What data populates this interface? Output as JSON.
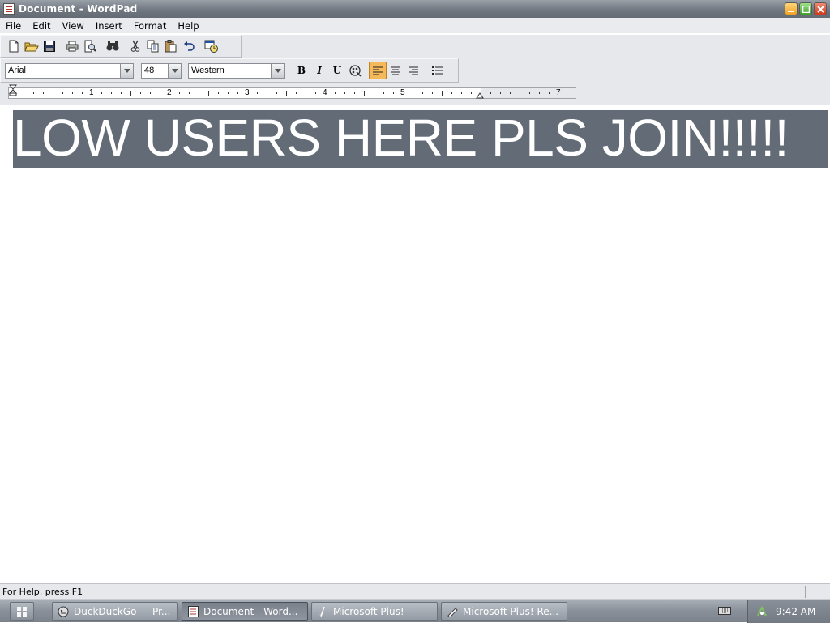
{
  "window": {
    "title": "Document - WordPad",
    "minimize_icon": "minimize-icon",
    "maximize_icon": "maximize-icon",
    "close_icon": "close-icon"
  },
  "menu": [
    "File",
    "Edit",
    "View",
    "Insert",
    "Format",
    "Help"
  ],
  "toolbar": {
    "icons": [
      "new-icon",
      "open-icon",
      "save-icon",
      "print-icon",
      "print-preview-icon",
      "find-icon",
      "cut-icon",
      "copy-icon",
      "paste-icon",
      "undo-icon",
      "insert-datetime-icon"
    ]
  },
  "format_bar": {
    "font": "Arial",
    "size": "48",
    "script": "Western",
    "bold_label": "B",
    "italic_label": "I",
    "underline_label": "U",
    "active_alignment": "left"
  },
  "ruler": {
    "numbers": [
      "1",
      "2",
      "3",
      "4",
      "5",
      "7"
    ]
  },
  "document": {
    "text": "LOW USERS HERE PLS JOIN!!!!!",
    "selection_color": "#636c76"
  },
  "status": {
    "text": "For Help, press F1"
  },
  "taskbar": {
    "tasks": [
      {
        "label": "DuckDuckGo — Pr...",
        "icon": "duckduckgo-icon",
        "active": false
      },
      {
        "label": "Document - Word...",
        "icon": "wordpad-icon",
        "active": true
      },
      {
        "label": "Microsoft Plus!",
        "icon": "plus-icon",
        "active": false
      },
      {
        "label": "Microsoft Plus! Re...",
        "icon": "plus-readme-icon",
        "active": false
      }
    ],
    "clock": "9:42 AM"
  }
}
